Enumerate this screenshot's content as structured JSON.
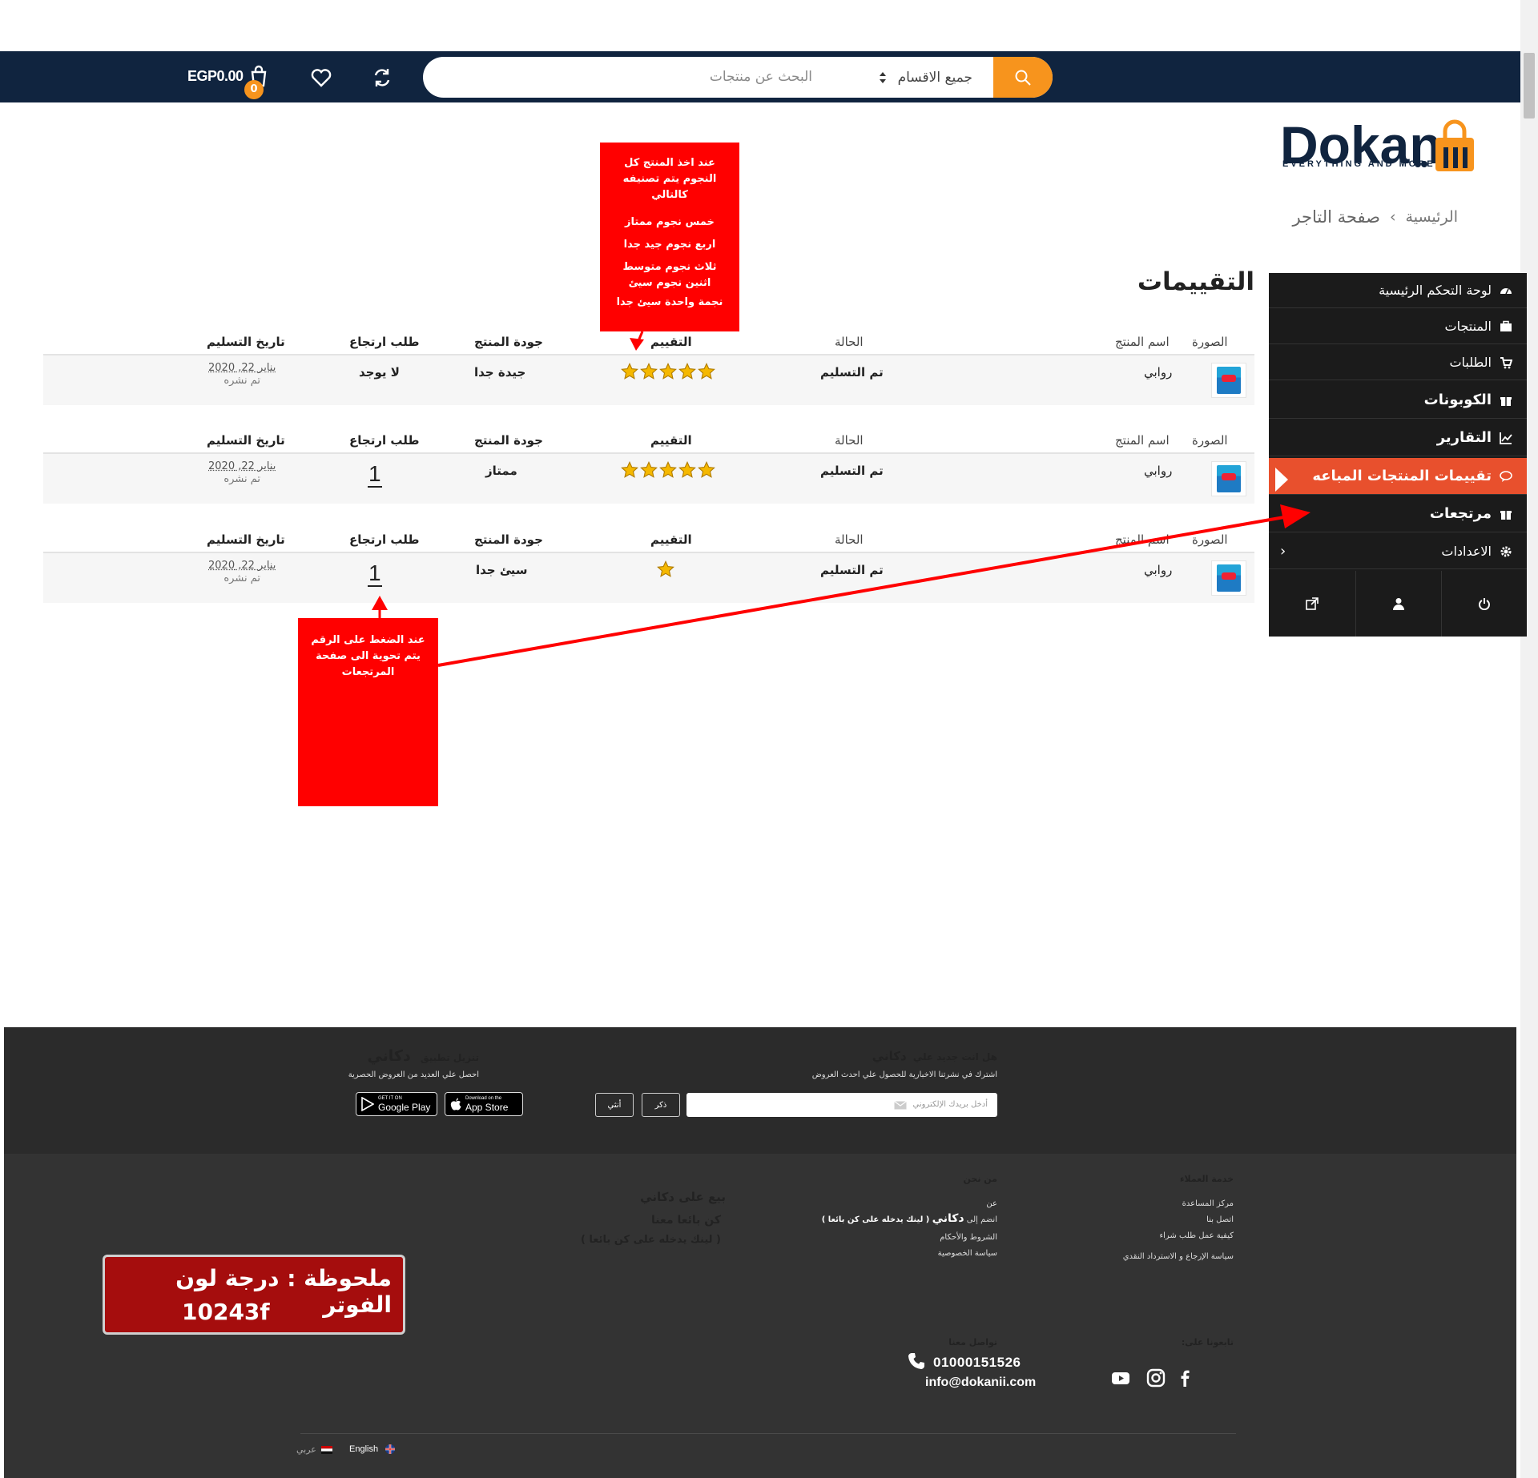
{
  "header": {
    "search_placeholder": "البحث عن منتجات",
    "category_select": "جميع الاقسام",
    "cart_total": "EGP0.00",
    "cart_count": "0"
  },
  "logo": {
    "brand": "Dokan",
    "tagline": "EVERYTHING AND MORE"
  },
  "breadcrumb": {
    "home": "الرئيسية",
    "separator": "›",
    "current": "صفحة التاجر"
  },
  "sidebar": {
    "items": [
      {
        "label": "لوحة التحكم الرئيسية",
        "icon": "dashboard-icon"
      },
      {
        "label": "المنتجات",
        "icon": "briefcase-icon"
      },
      {
        "label": "الطلبات",
        "icon": "cart-icon"
      },
      {
        "label": "الكوبونات",
        "icon": "gift-icon"
      },
      {
        "label": "التقارير",
        "icon": "chart-icon"
      },
      {
        "label": "تقييمات المنتجات المباعه",
        "icon": "comments-icon"
      },
      {
        "label": "مرتجعات",
        "icon": "gift-icon"
      },
      {
        "label": "الاعدادات",
        "icon": "gear-icon",
        "chevron": "‹"
      }
    ]
  },
  "main": {
    "title": "التقييمات",
    "columns": {
      "image": "الصورة",
      "product_name": "اسم المنتج",
      "status": "الحالة",
      "rating": "التقييم",
      "quality": "جودة المنتج",
      "return_request": "طلب ارتجاع",
      "delivery_date": "تاريخ التسليم"
    },
    "rows": [
      {
        "product": "روابي",
        "status": "تم التسليم",
        "rating": 5,
        "quality": "جيدة جدا",
        "return": "لا يوجد",
        "date": "يناير 22, 2020",
        "published": "تم نشره"
      },
      {
        "product": "روابي",
        "status": "تم التسليم",
        "rating": 5,
        "quality": "ممتاز",
        "return": "1",
        "date": "يناير 22, 2020",
        "published": "تم نشره"
      },
      {
        "product": "روابي",
        "status": "تم التسليم",
        "rating": 1,
        "quality": "سيئ جدا",
        "return": "1",
        "date": "يناير 22, 2020",
        "published": "تم نشره"
      }
    ]
  },
  "annotations": {
    "stars_note": [
      "عند اخذ المنتج كل",
      "النجوم يتم تصنيفه",
      "كالتالي",
      "",
      "خمس نجوم ممتاز",
      "اربع نجوم جيد جدا",
      "ثلاث نجوم متوسط",
      "اثنين نجوم سيئ",
      "نجمة واحدة سيئ جدا"
    ],
    "return_note": [
      "عند الضغط على الرقم",
      "يتم تحوية الى صفحة",
      "المرتجعات"
    ],
    "color_note_line1": "ملحوظة : درجة لون الفوتر",
    "color_note_line2": "10243f"
  },
  "footer": {
    "newsletter_title": "هل انت جديد علي",
    "newsletter_brand": "دكاني",
    "newsletter_sub": "اشترك في نشرتنا الاخبارية للحصول علي احدث العروض",
    "email_placeholder": "أدخل بريدك الإلكتروني",
    "male": "ذكر",
    "female": "أنثي",
    "app_title": "تنزيل تطبيق",
    "app_brand": "دكاني",
    "app_sub": "احصل علي العديد من العروض الحصرية",
    "google_small": "GET IT ON",
    "google_label": "Google Play",
    "apple_small": "Download on the",
    "apple_label": "App Store",
    "customer_service": {
      "title": "خدمة العملاء",
      "links": [
        "مركز المساعدة",
        "اتصل بنا",
        "كيفية عمل طلب شراء",
        "سياسة الإرجاع و الاسترداد النقدي"
      ]
    },
    "about": {
      "title": "من نحن",
      "links": [
        "عن",
        "الشروط والأحكام",
        "سياسة الخصوصية"
      ],
      "join_prefix": "انضم إلى",
      "join_brand": "دكاني",
      "join_note": "( لينك يدخله على كن بائعا )"
    },
    "sell": {
      "title": "بيع على دكاني",
      "be_seller": "كن بائعا معنا",
      "link_note": "( لينك يدخله على كن بائعا )"
    },
    "follow_title": "تابعونا على:",
    "contact_title": "تواصل معنا",
    "phone": "01000151526",
    "email": "info@dokanii.com",
    "lang_en": "English",
    "lang_ar": "عربي"
  },
  "colors": {
    "navbar": "#10243f",
    "accent": "#f7941d",
    "active_menu": "#e8502d",
    "annotation": "#ff0000",
    "star": "#f5b800"
  }
}
